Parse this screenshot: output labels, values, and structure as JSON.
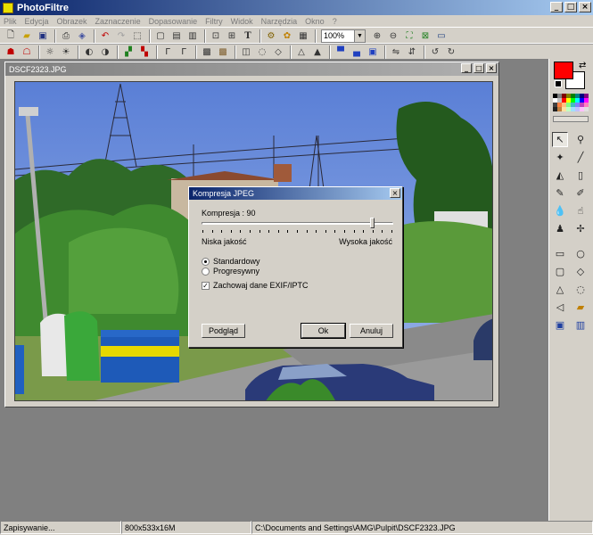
{
  "app": {
    "title": "PhotoFiltre",
    "window_buttons": [
      "_",
      "□",
      "×"
    ]
  },
  "menu": [
    "Plik",
    "Edycja",
    "Obrazek",
    "Zaznaczenie",
    "Dopasowanie",
    "Filtry",
    "Widok",
    "Narzędzia",
    "Okno",
    "?"
  ],
  "toolbar": {
    "zoom_value": "100%"
  },
  "document": {
    "title": "DSCF2323.JPG"
  },
  "dialog": {
    "title": "Kompresja JPEG",
    "compression_label": "Kompresja : 90",
    "compression_value": 90,
    "low_quality": "Niska jakość",
    "high_quality": "Wysoka jakość",
    "radio_standard": "Standardowy",
    "radio_progressive": "Progresywny",
    "checkbox_exif": "Zachowaj dane EXIF/IPTC",
    "btn_preview": "Podgląd",
    "btn_ok": "Ok",
    "btn_cancel": "Anuluj"
  },
  "status": {
    "state": "Zapisywanie...",
    "dims": "800x533x16M",
    "path": "C:\\Documents and Settings\\AMG\\Pulpit\\DSCF2323.JPG"
  },
  "colors": {
    "foreground": "#ff0000",
    "background": "#ffffff",
    "accent": "#0a246a"
  }
}
